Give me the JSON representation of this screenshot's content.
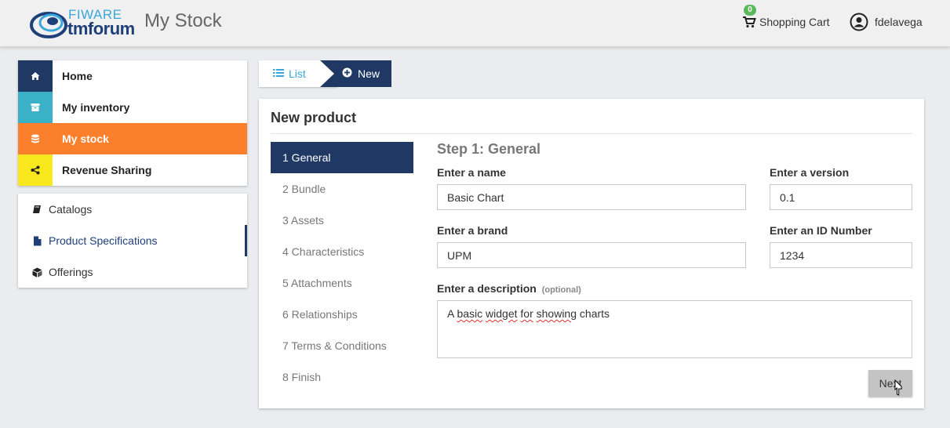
{
  "header": {
    "logo_top": "FIWARE",
    "logo_bottom": "tmforum",
    "title": "My Stock",
    "cart_count": "0",
    "cart_label": "Shopping Cart",
    "username": "fdelavega"
  },
  "sidebar": {
    "main": [
      {
        "label": "Home",
        "icon": "home-icon",
        "color": "#1f3864"
      },
      {
        "label": "My inventory",
        "icon": "archive-icon",
        "color": "#3bb1c8"
      },
      {
        "label": "My stock",
        "icon": "database-icon",
        "color": "#fc7f2c"
      },
      {
        "label": "Revenue Sharing",
        "icon": "share-icon",
        "color": "#f9e71e"
      }
    ],
    "sub": [
      {
        "label": "Catalogs",
        "icon": "book-icon"
      },
      {
        "label": "Product Specifications",
        "icon": "file-icon"
      },
      {
        "label": "Offerings",
        "icon": "cube-icon"
      }
    ]
  },
  "breadcrumb": {
    "list_label": "List",
    "new_label": "New"
  },
  "panel": {
    "title": "New product",
    "steps": [
      "1 General",
      "2 Bundle",
      "3 Assets",
      "4 Characteristics",
      "5 Attachments",
      "6 Relationships",
      "7 Terms & Conditions",
      "8 Finish"
    ],
    "step_heading": "Step 1: General",
    "fields": {
      "name_label": "Enter a name",
      "name_value": "Basic Chart",
      "version_label": "Enter a version",
      "version_value": "0.1",
      "brand_label": "Enter a brand",
      "brand_value": "UPM",
      "id_label": "Enter an ID Number",
      "id_value": "1234",
      "description_label": "Enter a description",
      "description_optional": "(optional)",
      "description_words": [
        "A",
        "basic",
        "widget",
        "for",
        "showing",
        "charts"
      ]
    },
    "next_label": "Next"
  }
}
